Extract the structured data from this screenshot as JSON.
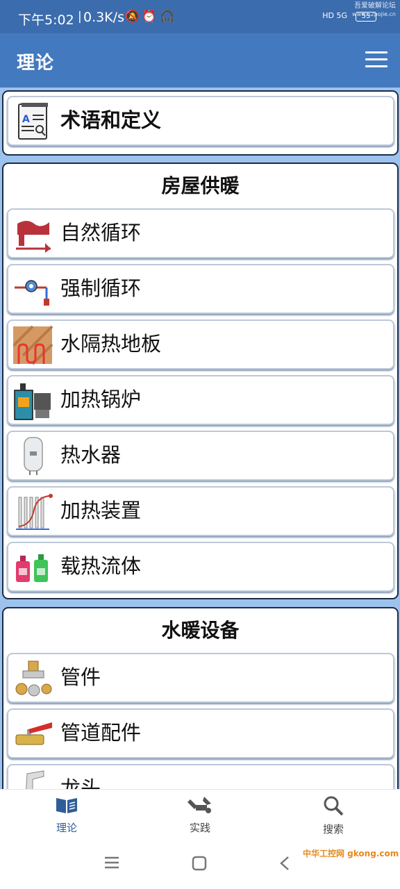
{
  "status_bar": {
    "time": "下午5:02",
    "speed": "0.3K/s",
    "network": "HD 5G",
    "battery": "55",
    "watermark_line1": "吾爱破解论坛",
    "watermark_line2": "www.52pojie.cn"
  },
  "app_bar": {
    "title": "理论"
  },
  "terms_card": {
    "item_label": "术语和定义",
    "icon": "book-icon"
  },
  "heating_section": {
    "title": "房屋供暖",
    "items": [
      {
        "label": "自然循环",
        "icon": "natural-circulation-icon"
      },
      {
        "label": "强制循环",
        "icon": "forced-circulation-icon"
      },
      {
        "label": "水隔热地板",
        "icon": "underfloor-heating-icon"
      },
      {
        "label": "加热锅炉",
        "icon": "boiler-icon"
      },
      {
        "label": "热水器",
        "icon": "water-heater-icon"
      },
      {
        "label": "加热装置",
        "icon": "radiator-icon"
      },
      {
        "label": "载热流体",
        "icon": "heat-fluid-icon"
      }
    ]
  },
  "plumbing_section": {
    "title": "水暖设备",
    "items": [
      {
        "label": "管件",
        "icon": "pipe-fittings-icon"
      },
      {
        "label": "管道配件",
        "icon": "valve-icon"
      },
      {
        "label": "龙头",
        "icon": "faucet-icon"
      }
    ]
  },
  "bottom_nav": {
    "items": [
      {
        "label": "理论",
        "icon": "open-book-icon",
        "active": true
      },
      {
        "label": "实践",
        "icon": "tools-icon",
        "active": false
      },
      {
        "label": "搜索",
        "icon": "search-icon",
        "active": false
      }
    ]
  },
  "corner_watermark": "中华工控网 gkong.com",
  "colors": {
    "status_bar": "#3b6cad",
    "app_bar": "#4379bf",
    "content_bg": "#9dc2ee",
    "active_nav": "#2e5e99"
  }
}
